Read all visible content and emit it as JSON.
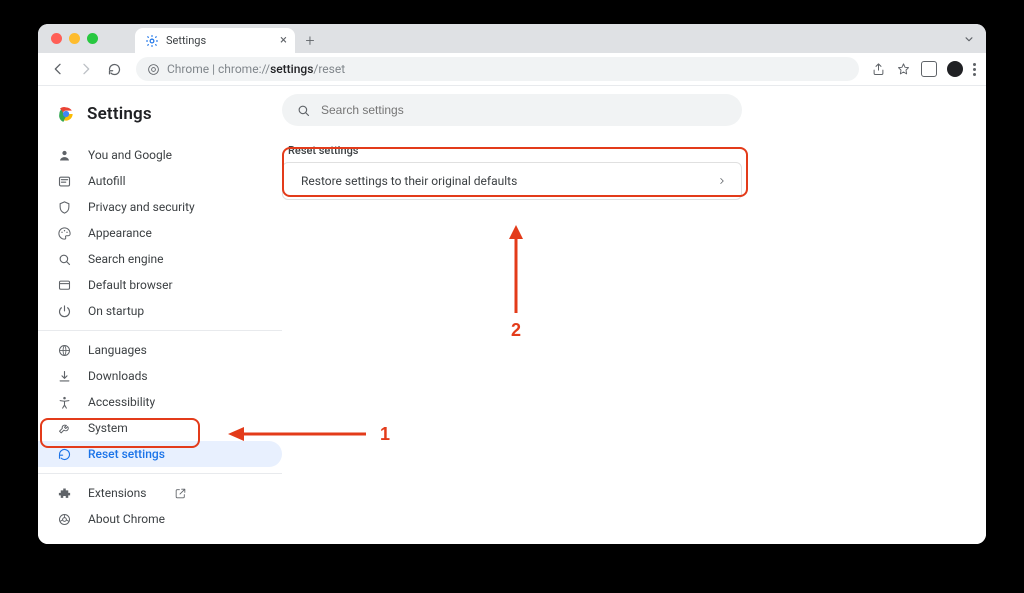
{
  "tab": {
    "title": "Settings"
  },
  "urlbar": {
    "scheme_host": "Chrome",
    "path_prefix": "chrome://",
    "path_strong": "settings",
    "path_suffix": "/reset"
  },
  "brand": {
    "title": "Settings"
  },
  "sidebar": {
    "items": [
      {
        "label": "You and Google"
      },
      {
        "label": "Autofill"
      },
      {
        "label": "Privacy and security"
      },
      {
        "label": "Appearance"
      },
      {
        "label": "Search engine"
      },
      {
        "label": "Default browser"
      },
      {
        "label": "On startup"
      },
      {
        "label": "Languages"
      },
      {
        "label": "Downloads"
      },
      {
        "label": "Accessibility"
      },
      {
        "label": "System"
      },
      {
        "label": "Reset settings"
      },
      {
        "label": "Extensions"
      },
      {
        "label": "About Chrome"
      }
    ]
  },
  "search": {
    "placeholder": "Search settings"
  },
  "section": {
    "title": "Reset settings"
  },
  "card": {
    "label": "Restore settings to their original defaults"
  },
  "annotations": {
    "one": "1",
    "two": "2"
  }
}
